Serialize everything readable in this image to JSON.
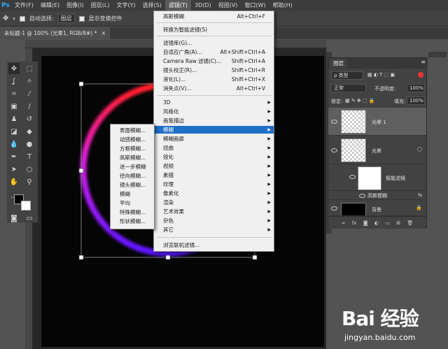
{
  "menubar": {
    "logo": "Ps",
    "items": [
      "文件(F)",
      "编辑(E)",
      "图像(I)",
      "图层(L)",
      "文字(Y)",
      "选择(S)",
      "滤镜(T)",
      "3D(D)",
      "视图(V)",
      "窗口(W)",
      "帮助(H)"
    ],
    "active_index": 6
  },
  "options_bar": {
    "auto_select_label": "自动选择:",
    "auto_select_value": "图层",
    "transform_label": "显示变换控件"
  },
  "doc_tab": {
    "title": "未标题-1 @ 100% (光晕1, RGB/8#) *",
    "close": "×"
  },
  "filter_menu": {
    "items": [
      {
        "label": "高斯模糊",
        "shortcut": "Alt+Ctrl+F"
      },
      {
        "label": "转换为智能滤镜(S)",
        "shortcut": ""
      },
      {
        "label": "滤镜库(G)...",
        "shortcut": ""
      },
      {
        "label": "自适应广角(A)...",
        "shortcut": "Alt+Shift+Ctrl+A"
      },
      {
        "label": "Camera Raw 滤镜(C)...",
        "shortcut": "Shift+Ctrl+A"
      },
      {
        "label": "镜头校正(R)...",
        "shortcut": "Shift+Ctrl+R"
      },
      {
        "label": "液化(L)...",
        "shortcut": "Shift+Ctrl+X"
      },
      {
        "label": "消失点(V)...",
        "shortcut": "Alt+Ctrl+V"
      },
      {
        "label": "3D",
        "submenu": true
      },
      {
        "label": "风格化",
        "submenu": true
      },
      {
        "label": "画笔描边",
        "submenu": true
      },
      {
        "label": "模糊",
        "submenu": true,
        "highlighted": true
      },
      {
        "label": "模糊画廊",
        "submenu": true
      },
      {
        "label": "扭曲",
        "submenu": true
      },
      {
        "label": "锐化",
        "submenu": true
      },
      {
        "label": "视频",
        "submenu": true
      },
      {
        "label": "素描",
        "submenu": true
      },
      {
        "label": "纹理",
        "submenu": true
      },
      {
        "label": "像素化",
        "submenu": true
      },
      {
        "label": "渲染",
        "submenu": true
      },
      {
        "label": "艺术效果",
        "submenu": true
      },
      {
        "label": "杂色",
        "submenu": true
      },
      {
        "label": "其它",
        "submenu": true
      },
      {
        "label": "浏览联机滤镜...",
        "shortcut": ""
      }
    ]
  },
  "blur_submenu": {
    "items": [
      "表面模糊...",
      "动感模糊...",
      "方框模糊...",
      "高斯模糊...",
      "进一步模糊",
      "径向模糊...",
      "镜头模糊...",
      "模糊",
      "平均",
      "特殊模糊...",
      "形状模糊..."
    ]
  },
  "layers_panel": {
    "tab_label": "图层",
    "kind_label": "ρ 类型",
    "blend_mode": "正常",
    "opacity_label": "不透明度:",
    "opacity_value": "100%",
    "lock_label": "锁定:",
    "fill_label": "填充:",
    "fill_value": "100%",
    "layers": [
      {
        "name": "光晕 1",
        "selected": true
      },
      {
        "name": "光晕",
        "selected": false
      },
      {
        "name": "智能滤镜",
        "selected": false
      },
      {
        "name": "高斯模糊",
        "selected": false
      },
      {
        "name": "背景",
        "selected": false
      }
    ],
    "footer_icons": [
      "link-icon",
      "fx-icon",
      "mask-icon",
      "adjustment-icon",
      "folder-icon",
      "new-layer-icon",
      "trash-icon"
    ],
    "footer_fx": "fx"
  },
  "watermark": {
    "logo": "Bai 经验",
    "url": "jingyan.baidu.com"
  },
  "colors": {
    "ring_top": "#ff1e1e",
    "ring_left": "#d01ed8",
    "ring_bottom": "#5a14ff",
    "menu_highlight": "#1e6fc8"
  }
}
